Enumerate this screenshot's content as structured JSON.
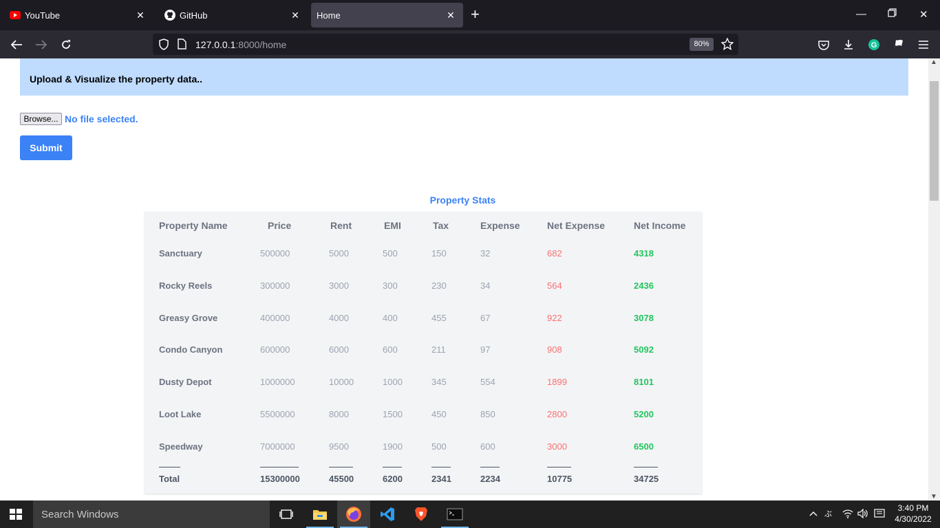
{
  "browser": {
    "tabs": [
      {
        "title": "YouTube",
        "active": false
      },
      {
        "title": "GitHub",
        "active": false
      },
      {
        "title": "Home",
        "active": true
      }
    ],
    "url_host": "127.0.0.1",
    "url_path": ":8000/home",
    "zoom": "80%"
  },
  "page": {
    "banner": "Upload & Visualize the property data..",
    "browse_label": "Browse...",
    "no_file_text": "No file selected.",
    "submit_label": "Submit",
    "stats_title": "Property Stats",
    "columns": [
      "Property Name",
      "Price",
      "Rent",
      "EMI",
      "Tax",
      "Expense",
      "Net Expense",
      "Net Income"
    ],
    "rows": [
      [
        "Sanctuary",
        "500000",
        "5000",
        "500",
        "150",
        "32",
        "682",
        "4318"
      ],
      [
        "Rocky Reels",
        "300000",
        "3000",
        "300",
        "230",
        "34",
        "564",
        "2436"
      ],
      [
        "Greasy Grove",
        "400000",
        "4000",
        "400",
        "455",
        "67",
        "922",
        "3078"
      ],
      [
        "Condo Canyon",
        "600000",
        "6000",
        "600",
        "211",
        "97",
        "908",
        "5092"
      ],
      [
        "Dusty Depot",
        "1000000",
        "10000",
        "1000",
        "345",
        "554",
        "1899",
        "8101"
      ],
      [
        "Loot Lake",
        "5500000",
        "8000",
        "1500",
        "450",
        "850",
        "2800",
        "5200"
      ],
      [
        "Speedway",
        "7000000",
        "9500",
        "1900",
        "500",
        "600",
        "3000",
        "6500"
      ]
    ],
    "totals": [
      "Total",
      "15300000",
      "45500",
      "6200",
      "2341",
      "2234",
      "10775",
      "34725"
    ]
  },
  "taskbar": {
    "search_placeholder": "Search Windows",
    "time": "3:40 PM",
    "date": "4/30/2022"
  },
  "colors": {
    "banner_bg": "#bfdbfe",
    "accent_blue": "#3b82f6",
    "net_expense_red": "#f87171",
    "net_income_green": "#22c55e"
  }
}
